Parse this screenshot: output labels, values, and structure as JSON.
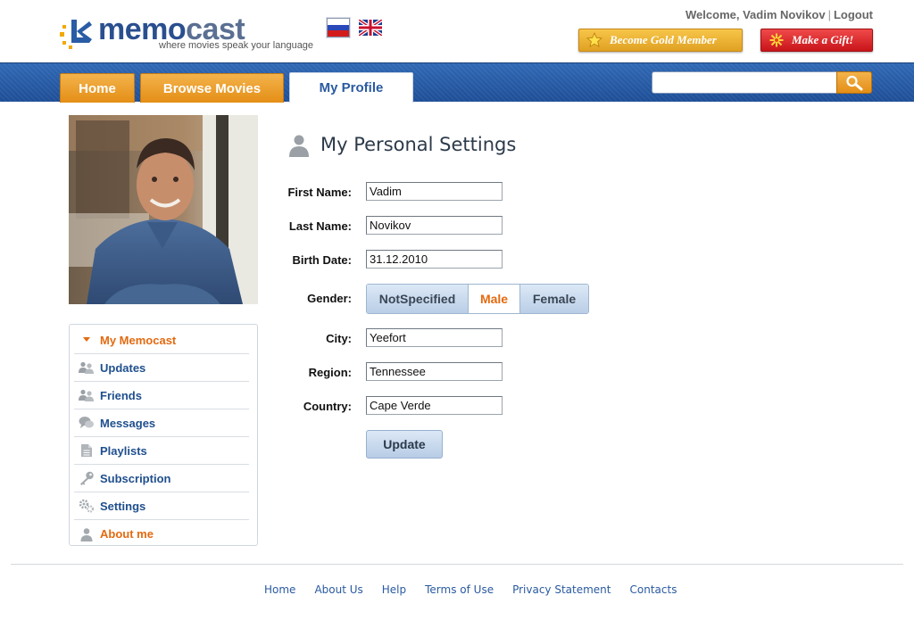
{
  "brand": {
    "name_part1": "memo",
    "name_part2": "cast",
    "tagline": "where movies speak your language"
  },
  "header": {
    "welcome_text": "Welcome, Vadim Novikov",
    "logout_label": "Logout",
    "gold_button_label": "Become Gold Member",
    "gift_button_label": "Make a Gift!",
    "languages": [
      "ru",
      "en"
    ]
  },
  "nav": {
    "tabs": [
      {
        "label": "Home",
        "active": false
      },
      {
        "label": "Browse Movies",
        "active": false
      },
      {
        "label": "My Profile",
        "active": true
      }
    ],
    "search": {
      "value": "",
      "placeholder": ""
    }
  },
  "sidebar": {
    "items": [
      {
        "label": "My Memocast",
        "icon": "triangle-down-icon",
        "highlight": true
      },
      {
        "label": "Updates",
        "icon": "users-icon",
        "highlight": false
      },
      {
        "label": "Friends",
        "icon": "users-icon",
        "highlight": false
      },
      {
        "label": "Messages",
        "icon": "speech-bubbles-icon",
        "highlight": false
      },
      {
        "label": "Playlists",
        "icon": "document-icon",
        "highlight": false
      },
      {
        "label": "Subscription",
        "icon": "key-icon",
        "highlight": false
      },
      {
        "label": "Settings",
        "icon": "gears-icon",
        "highlight": false
      },
      {
        "label": "About me",
        "icon": "user-icon",
        "highlight": true
      }
    ]
  },
  "main": {
    "title": "My Personal Settings",
    "fields": {
      "first_name": {
        "label": "First Name:",
        "value": "Vadim"
      },
      "last_name": {
        "label": "Last Name:",
        "value": "Novikov"
      },
      "birth_date": {
        "label": "Birth Date:",
        "value": "31.12.2010"
      },
      "gender": {
        "label": "Gender:",
        "options": [
          "NotSpecified",
          "Male",
          "Female"
        ],
        "selected": "Male"
      },
      "city": {
        "label": "City:",
        "value": "Yeefort"
      },
      "region": {
        "label": "Region:",
        "value": "Tennessee"
      },
      "country": {
        "label": "Country:",
        "value": "Cape Verde"
      }
    },
    "update_label": "Update"
  },
  "footer": {
    "links": [
      "Home",
      "About Us",
      "Help",
      "Terms of Use",
      "Privacy Statement",
      "Contacts"
    ]
  },
  "colors": {
    "nav_blue": "#2a5ca5",
    "accent_orange": "#e48e16",
    "link_blue": "#1f4f8e",
    "highlight_orange": "#e36a10"
  }
}
